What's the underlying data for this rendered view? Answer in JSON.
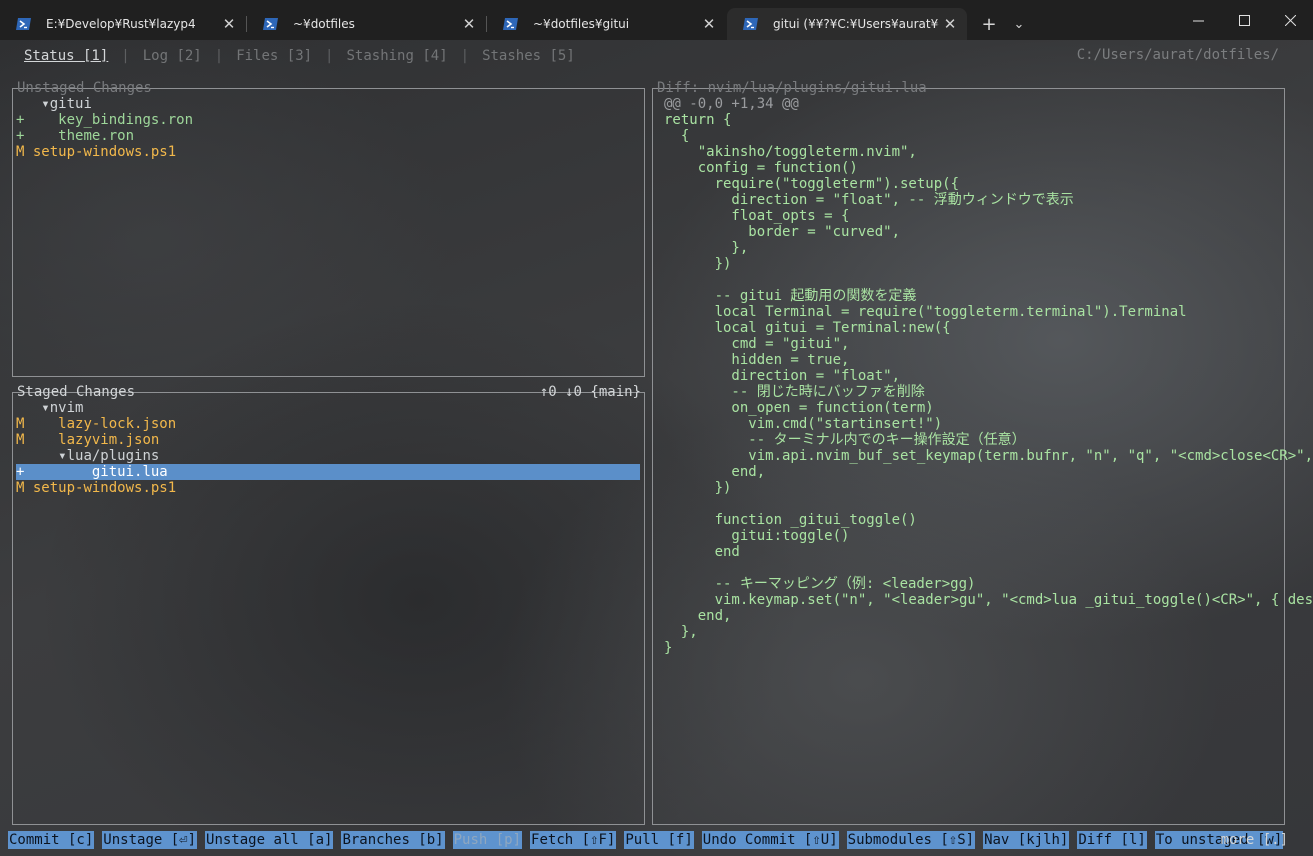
{
  "window": {
    "tabs": [
      {
        "label": "E:¥Develop¥Rust¥lazyp4",
        "active": false
      },
      {
        "label": "~¥dotfiles",
        "active": false
      },
      {
        "label": "~¥dotfiles¥gitui",
        "active": false
      },
      {
        "label": "gitui (¥¥?¥C:¥Users¥aurat¥dot",
        "active": true
      }
    ],
    "new_tab_symbol": "+",
    "dropdown_symbol": "⌄"
  },
  "menu": {
    "tabs": [
      "Status [1]",
      "Log [2]",
      "Files [3]",
      "Stashing [4]",
      "Stashes [5]"
    ],
    "active_index": 0,
    "separator": "|",
    "repo_path": "C:/Users/aurat/dotfiles/"
  },
  "unstaged": {
    "title": "Unstaged Changes",
    "items": [
      {
        "marker": " ",
        "text": "  ▾gitui",
        "kind": "dir"
      },
      {
        "marker": "+",
        "text": "    key_bindings.ron",
        "kind": "add"
      },
      {
        "marker": "+",
        "text": "    theme.ron",
        "kind": "add"
      },
      {
        "marker": "M",
        "text": " setup-windows.ps1",
        "kind": "mod"
      }
    ]
  },
  "staged": {
    "title": "Staged Changes",
    "status": "↑0 ↓0 {main}",
    "items": [
      {
        "marker": " ",
        "text": "  ▾nvim",
        "kind": "dir"
      },
      {
        "marker": "M",
        "text": "    lazy-lock.json",
        "kind": "mod"
      },
      {
        "marker": "M",
        "text": "    lazyvim.json",
        "kind": "mod"
      },
      {
        "marker": " ",
        "text": "    ▾lua/plugins",
        "kind": "dir"
      },
      {
        "marker": "+",
        "text": "        gitui.lua",
        "kind": "sel"
      },
      {
        "marker": "M",
        "text": " setup-windows.ps1",
        "kind": "mod"
      }
    ]
  },
  "diff": {
    "title": "Diff: nvim/lua/plugins/gitui.lua",
    "hunk": "@@ -0,0 +1,34 @@",
    "lines": [
      "return {",
      "  {",
      "    \"akinsho/toggleterm.nvim\",",
      "    config = function()",
      "      require(\"toggleterm\").setup({",
      "        direction = \"float\", -- 浮動ウィンドウで表示",
      "        float_opts = {",
      "          border = \"curved\",",
      "        },",
      "      })",
      "",
      "      -- gitui 起動用の関数を定義",
      "      local Terminal = require(\"toggleterm.terminal\").Terminal",
      "      local gitui = Terminal:new({",
      "        cmd = \"gitui\",",
      "        hidden = true,",
      "        direction = \"float\",",
      "        -- 閉じた時にバッファを削除",
      "        on_open = function(term)",
      "          vim.cmd(\"startinsert!\")",
      "          -- ターミナル内でのキー操作設定（任意）",
      "          vim.api.nvim_buf_set_keymap(term.bufnr, \"n\", \"q\", \"<cmd>close<CR>\", {",
      "        end,",
      "      })",
      "",
      "      function _gitui_toggle()",
      "        gitui:toggle()",
      "      end",
      "",
      "      -- キーマッピング（例: <leader>gg)",
      "      vim.keymap.set(\"n\", \"<leader>gu\", \"<cmd>lua _gitui_toggle()<CR>\", { des",
      "    end,",
      "  },",
      "}"
    ]
  },
  "keybar": {
    "commands": [
      {
        "label": "Commit [c]",
        "enabled": true
      },
      {
        "label": "Unstage [⏎]",
        "enabled": true
      },
      {
        "label": "Unstage all [a]",
        "enabled": true
      },
      {
        "label": "Branches [b]",
        "enabled": true
      },
      {
        "label": "Push [p]",
        "enabled": false
      },
      {
        "label": "Fetch [⇧F]",
        "enabled": true
      },
      {
        "label": "Pull [f]",
        "enabled": true
      },
      {
        "label": "Undo Commit [⇧U]",
        "enabled": true
      },
      {
        "label": "Submodules [⇧S]",
        "enabled": true
      },
      {
        "label": "Nav [kjlh]",
        "enabled": true
      },
      {
        "label": "Diff [l]",
        "enabled": true
      },
      {
        "label": "To unstaged [w]",
        "enabled": true
      }
    ],
    "more": "more [.]"
  }
}
